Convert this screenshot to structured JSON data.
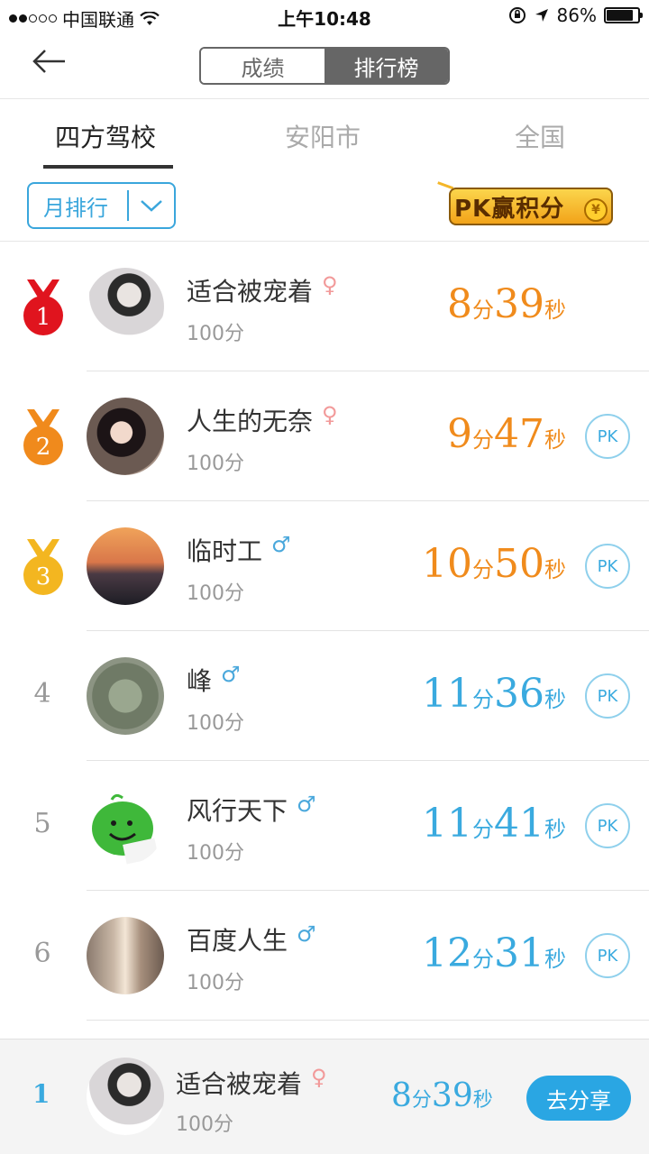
{
  "status_bar": {
    "carrier": "中国联通",
    "time": "上午10:48",
    "battery": "86%",
    "battery_level": 0.86
  },
  "nav": {
    "back_icon": "arrow-left-icon",
    "segments": [
      "成绩",
      "排行榜"
    ],
    "active_segment": "排行榜"
  },
  "tabs": [
    "四方驾校",
    "安阳市",
    "全国"
  ],
  "active_tab": "四方驾校",
  "filter": {
    "label": "月排行",
    "icon": "chevron-down-icon"
  },
  "pk_banner": {
    "text": "PK赢积分",
    "coin": "¥"
  },
  "rankings": [
    {
      "rank": "1",
      "name": "适合被宠着",
      "gender": "♀",
      "score": "100分",
      "min": "8",
      "sec": "39",
      "min_unit": "分",
      "sec_unit": "秒",
      "pk": ""
    },
    {
      "rank": "2",
      "name": "人生的无奈",
      "gender": "♀",
      "score": "100分",
      "min": "9",
      "sec": "47",
      "min_unit": "分",
      "sec_unit": "秒",
      "pk": "PK"
    },
    {
      "rank": "3",
      "name": "临时工",
      "gender": "♂",
      "score": "100分",
      "min": "10",
      "sec": "50",
      "min_unit": "分",
      "sec_unit": "秒",
      "pk": "PK"
    },
    {
      "rank": "4",
      "name": "峰",
      "gender": "♂",
      "score": "100分",
      "min": "11",
      "sec": "36",
      "min_unit": "分",
      "sec_unit": "秒",
      "pk": "PK"
    },
    {
      "rank": "5",
      "name": "风行天下",
      "gender": "♂",
      "score": "100分",
      "min": "11",
      "sec": "41",
      "min_unit": "分",
      "sec_unit": "秒",
      "pk": "PK"
    },
    {
      "rank": "6",
      "name": "百度人生",
      "gender": "♂",
      "score": "100分",
      "min": "12",
      "sec": "31",
      "min_unit": "分",
      "sec_unit": "秒",
      "pk": "PK"
    }
  ],
  "my_rank": {
    "rank": "1",
    "name": "适合被宠着",
    "gender": "♀",
    "score": "100分",
    "min": "8",
    "sec": "39",
    "min_unit": "分",
    "sec_unit": "秒",
    "share_label": "去分享"
  },
  "colors": {
    "accent": "#3aaadf",
    "top3_time": "#f08b1c",
    "medal_gold": "#f3b620",
    "medal_silver": "#f08a1c",
    "medal_red": "#e0141e"
  }
}
